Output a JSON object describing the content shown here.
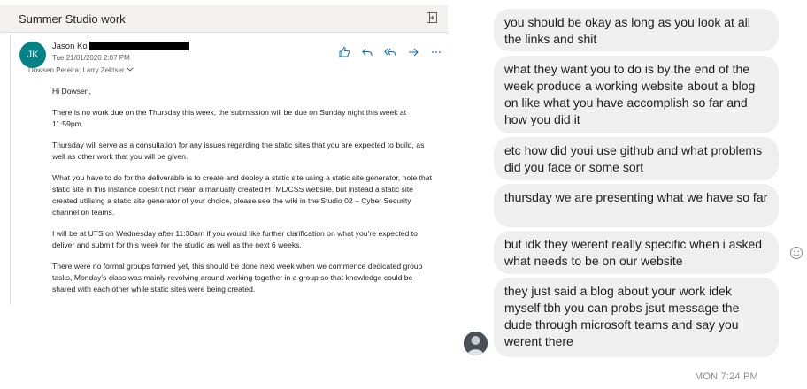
{
  "email": {
    "subject": "Summer Studio work",
    "sender": "Jason Ko",
    "avatar_initials": "JK",
    "date": "Tue 21/01/2020 2:07 PM",
    "recipients": "Dowsen Pereira; Larry Zektser",
    "paragraphs": [
      "Hi Dowsen,",
      "There is no work due on the Thursday this week, the submission will be due on Sunday night this week at 11:59pm.",
      "Thursday will serve as a consultation for any issues regarding the static sites that you are expected to build, as well as other work that you will be given.",
      "What you have to do for the deliverable is to create and deploy a static site using a static site generator, note that static site in this instance doesn’t not mean a manually created HTML/CSS website, but instead a static site created utilising a static site generator of your choice, please see the wiki in the Studio 02 – Cyber Security channel on teams.",
      "I will be at UTS on Wednesday after 11:30am if you would like further clarification on what you’re expected to deliver and submit for this week for the studio as well as the next 6 weeks.",
      "There were no formal groups formed yet, this should be done next week when we commence dedicated group tasks, Monday’s class was mainly revolving around working together in a group so that knowledge could be shared with each other while static sites were being created."
    ],
    "colors": {
      "avatar": "#038387",
      "action_icons": "#0f6cbd"
    }
  },
  "chat": {
    "messages": [
      "you should be okay as long as you look at all the links and shit",
      "what they want you to do is by the end of the week produce a working website about a blog on like what you have accomplish so far and how you did it",
      "etc how did youi use github and what problems did you face or some sort",
      "thursday we are presenting what we have so far",
      "but idk they werent really specific when i asked what needs to be on our website",
      "they just said a blog about your work idek myself tbh you can probs jsut message the dude through microsoft teams and say you werent there"
    ],
    "timestamp": "MON 7:24 PM",
    "bubble_color": "#efefef"
  }
}
